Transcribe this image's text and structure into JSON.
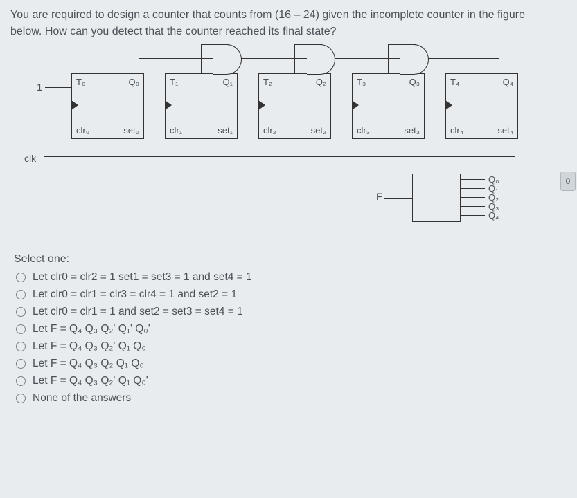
{
  "question": {
    "line1": "You are required to design a counter that counts from (16 – 24) given the incomplete counter in the figure",
    "line2": "below. How can you detect that the counter reached its final state?"
  },
  "figure": {
    "input1": "1",
    "clk": "clk",
    "flipflops": [
      {
        "t": "T₀",
        "q": "Q₀",
        "clr": "clr₀",
        "set": "set₀"
      },
      {
        "t": "T₁",
        "q": "Q₁",
        "clr": "clr₁",
        "set": "set₁"
      },
      {
        "t": "T₂",
        "q": "Q₂",
        "clr": "clr₂",
        "set": "set₂"
      },
      {
        "t": "T₃",
        "q": "Q₃",
        "clr": "clr₃",
        "set": "set₃"
      },
      {
        "t": "T₄",
        "q": "Q₄",
        "clr": "clr₄",
        "set": "set₄"
      }
    ],
    "fblock": {
      "label": "F",
      "outputs": [
        "Q₀",
        "Q₁",
        "Q₂",
        "Q₃",
        "Q₄"
      ]
    }
  },
  "select_one": "Select one:",
  "options": [
    "Let clr0 = clr2 = 1 set1 = set3 = 1 and set4 = 1",
    "Let clr0 = clr1 = clr3 = clr4 = 1 and set2 = 1",
    "Let clr0 = clr1 = 1 and set2 = set3 = set4 = 1",
    "Let F = Q₄ Q₃ Q₂' Q₁' Q₀'",
    "Let F = Q₄ Q₃ Q₂' Q₁ Q₀",
    "Let F = Q₄ Q₃ Q₂ Q₁ Q₀",
    "Let F = Q₄ Q₃ Q₂' Q₁ Q₀'",
    "None of the answers"
  ],
  "corner": "0"
}
